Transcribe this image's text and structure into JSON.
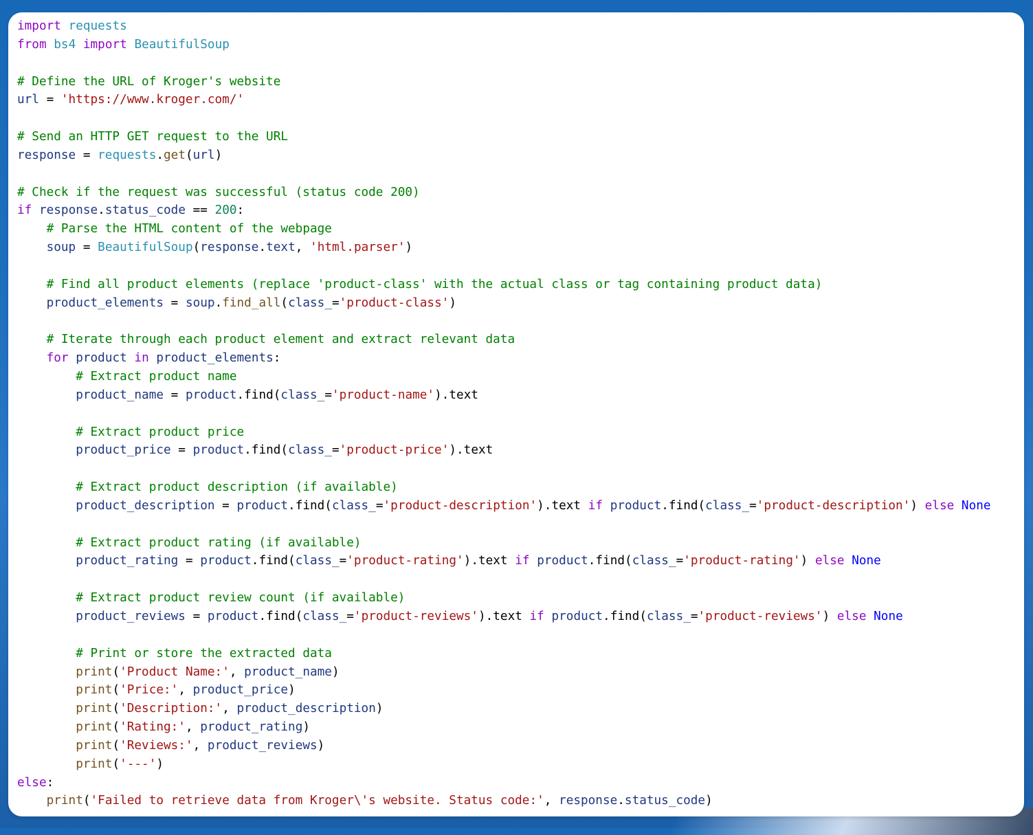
{
  "colors": {
    "keyword": "#8f08c4",
    "string": "#a31515",
    "comment": "#008000",
    "function": "#74531f",
    "class": "#2b91af",
    "number": "#098658",
    "variable": "#1f377f",
    "operator": "#000000",
    "constant": "#0000ff"
  },
  "code_lines": [
    [
      [
        "kw",
        "import"
      ],
      [
        "op",
        " "
      ],
      [
        "cls",
        "requests"
      ]
    ],
    [
      [
        "kw",
        "from"
      ],
      [
        "op",
        " "
      ],
      [
        "cls",
        "bs4"
      ],
      [
        "op",
        " "
      ],
      [
        "kw",
        "import"
      ],
      [
        "op",
        " "
      ],
      [
        "cls",
        "BeautifulSoup"
      ]
    ],
    [],
    [
      [
        "cm",
        "# Define the URL of Kroger's website"
      ]
    ],
    [
      [
        "var",
        "url"
      ],
      [
        "op",
        " = "
      ],
      [
        "str",
        "'https://www.kroger.com/'"
      ]
    ],
    [],
    [
      [
        "cm",
        "# Send an HTTP GET request to the URL"
      ]
    ],
    [
      [
        "var",
        "response"
      ],
      [
        "op",
        " = "
      ],
      [
        "cls",
        "requests"
      ],
      [
        "op",
        "."
      ],
      [
        "fn",
        "get"
      ],
      [
        "op",
        "("
      ],
      [
        "var",
        "url"
      ],
      [
        "op",
        ")"
      ]
    ],
    [],
    [
      [
        "cm",
        "# Check if the request was successful (status code 200)"
      ]
    ],
    [
      [
        "kw",
        "if"
      ],
      [
        "op",
        " "
      ],
      [
        "var",
        "response"
      ],
      [
        "op",
        "."
      ],
      [
        "var",
        "status_code"
      ],
      [
        "op",
        " == "
      ],
      [
        "num",
        "200"
      ],
      [
        "op",
        ":"
      ]
    ],
    [
      [
        "op",
        "    "
      ],
      [
        "cm",
        "# Parse the HTML content of the webpage"
      ]
    ],
    [
      [
        "op",
        "    "
      ],
      [
        "var",
        "soup"
      ],
      [
        "op",
        " = "
      ],
      [
        "cls",
        "BeautifulSoup"
      ],
      [
        "op",
        "("
      ],
      [
        "var",
        "response"
      ],
      [
        "op",
        "."
      ],
      [
        "var",
        "text"
      ],
      [
        "op",
        ", "
      ],
      [
        "str",
        "'html.parser'"
      ],
      [
        "op",
        ")"
      ]
    ],
    [],
    [
      [
        "op",
        "    "
      ],
      [
        "cm",
        "# Find all product elements (replace 'product-class' with the actual class or tag containing product data)"
      ]
    ],
    [
      [
        "op",
        "    "
      ],
      [
        "var",
        "product_elements"
      ],
      [
        "op",
        " = "
      ],
      [
        "var",
        "soup"
      ],
      [
        "op",
        "."
      ],
      [
        "fn",
        "find_all"
      ],
      [
        "op",
        "("
      ],
      [
        "var",
        "class_"
      ],
      [
        "op",
        "="
      ],
      [
        "str",
        "'product-class'"
      ],
      [
        "op",
        ")"
      ]
    ],
    [],
    [
      [
        "op",
        "    "
      ],
      [
        "cm",
        "# Iterate through each product element and extract relevant data"
      ]
    ],
    [
      [
        "op",
        "    "
      ],
      [
        "kw",
        "for"
      ],
      [
        "op",
        " "
      ],
      [
        "var",
        "product"
      ],
      [
        "op",
        " "
      ],
      [
        "kw",
        "in"
      ],
      [
        "op",
        " "
      ],
      [
        "var",
        "product_elements"
      ],
      [
        "op",
        ":"
      ]
    ],
    [
      [
        "op",
        "        "
      ],
      [
        "cm",
        "# Extract product name"
      ]
    ],
    [
      [
        "op",
        "        "
      ],
      [
        "var",
        "product_name"
      ],
      [
        "op",
        " = "
      ],
      [
        "var",
        "product"
      ],
      [
        "op",
        "."
      ],
      [
        "op",
        "find"
      ],
      [
        "op",
        "("
      ],
      [
        "var",
        "class_"
      ],
      [
        "op",
        "="
      ],
      [
        "str",
        "'product-name'"
      ],
      [
        "op",
        ")."
      ],
      [
        "op",
        "text"
      ]
    ],
    [],
    [
      [
        "op",
        "        "
      ],
      [
        "cm",
        "# Extract product price"
      ]
    ],
    [
      [
        "op",
        "        "
      ],
      [
        "var",
        "product_price"
      ],
      [
        "op",
        " = "
      ],
      [
        "var",
        "product"
      ],
      [
        "op",
        "."
      ],
      [
        "op",
        "find"
      ],
      [
        "op",
        "("
      ],
      [
        "var",
        "class_"
      ],
      [
        "op",
        "="
      ],
      [
        "str",
        "'product-price'"
      ],
      [
        "op",
        ")."
      ],
      [
        "op",
        "text"
      ]
    ],
    [],
    [
      [
        "op",
        "        "
      ],
      [
        "cm",
        "# Extract product description (if available)"
      ]
    ],
    [
      [
        "op",
        "        "
      ],
      [
        "var",
        "product_description"
      ],
      [
        "op",
        " = "
      ],
      [
        "var",
        "product"
      ],
      [
        "op",
        "."
      ],
      [
        "op",
        "find"
      ],
      [
        "op",
        "("
      ],
      [
        "var",
        "class_"
      ],
      [
        "op",
        "="
      ],
      [
        "str",
        "'product-description'"
      ],
      [
        "op",
        ")."
      ],
      [
        "op",
        "text"
      ],
      [
        "op",
        " "
      ],
      [
        "kw",
        "if"
      ],
      [
        "op",
        " "
      ],
      [
        "var",
        "product"
      ],
      [
        "op",
        "."
      ],
      [
        "op",
        "find"
      ],
      [
        "op",
        "("
      ],
      [
        "var",
        "class_"
      ],
      [
        "op",
        "="
      ],
      [
        "str",
        "'product-description'"
      ],
      [
        "op",
        ") "
      ],
      [
        "kw",
        "else"
      ],
      [
        "op",
        " "
      ],
      [
        "none",
        "None"
      ]
    ],
    [],
    [
      [
        "op",
        "        "
      ],
      [
        "cm",
        "# Extract product rating (if available)"
      ]
    ],
    [
      [
        "op",
        "        "
      ],
      [
        "var",
        "product_rating"
      ],
      [
        "op",
        " = "
      ],
      [
        "var",
        "product"
      ],
      [
        "op",
        "."
      ],
      [
        "op",
        "find"
      ],
      [
        "op",
        "("
      ],
      [
        "var",
        "class_"
      ],
      [
        "op",
        "="
      ],
      [
        "str",
        "'product-rating'"
      ],
      [
        "op",
        ")."
      ],
      [
        "op",
        "text"
      ],
      [
        "op",
        " "
      ],
      [
        "kw",
        "if"
      ],
      [
        "op",
        " "
      ],
      [
        "var",
        "product"
      ],
      [
        "op",
        "."
      ],
      [
        "op",
        "find"
      ],
      [
        "op",
        "("
      ],
      [
        "var",
        "class_"
      ],
      [
        "op",
        "="
      ],
      [
        "str",
        "'product-rating'"
      ],
      [
        "op",
        ") "
      ],
      [
        "kw",
        "else"
      ],
      [
        "op",
        " "
      ],
      [
        "none",
        "None"
      ]
    ],
    [],
    [
      [
        "op",
        "        "
      ],
      [
        "cm",
        "# Extract product review count (if available)"
      ]
    ],
    [
      [
        "op",
        "        "
      ],
      [
        "var",
        "product_reviews"
      ],
      [
        "op",
        " = "
      ],
      [
        "var",
        "product"
      ],
      [
        "op",
        "."
      ],
      [
        "op",
        "find"
      ],
      [
        "op",
        "("
      ],
      [
        "var",
        "class_"
      ],
      [
        "op",
        "="
      ],
      [
        "str",
        "'product-reviews'"
      ],
      [
        "op",
        ")."
      ],
      [
        "op",
        "text"
      ],
      [
        "op",
        " "
      ],
      [
        "kw",
        "if"
      ],
      [
        "op",
        " "
      ],
      [
        "var",
        "product"
      ],
      [
        "op",
        "."
      ],
      [
        "op",
        "find"
      ],
      [
        "op",
        "("
      ],
      [
        "var",
        "class_"
      ],
      [
        "op",
        "="
      ],
      [
        "str",
        "'product-reviews'"
      ],
      [
        "op",
        ") "
      ],
      [
        "kw",
        "else"
      ],
      [
        "op",
        " "
      ],
      [
        "none",
        "None"
      ]
    ],
    [],
    [
      [
        "op",
        "        "
      ],
      [
        "cm",
        "# Print or store the extracted data"
      ]
    ],
    [
      [
        "op",
        "        "
      ],
      [
        "fn",
        "print"
      ],
      [
        "op",
        "("
      ],
      [
        "str",
        "'Product Name:'"
      ],
      [
        "op",
        ", "
      ],
      [
        "var",
        "product_name"
      ],
      [
        "op",
        ")"
      ]
    ],
    [
      [
        "op",
        "        "
      ],
      [
        "fn",
        "print"
      ],
      [
        "op",
        "("
      ],
      [
        "str",
        "'Price:'"
      ],
      [
        "op",
        ", "
      ],
      [
        "var",
        "product_price"
      ],
      [
        "op",
        ")"
      ]
    ],
    [
      [
        "op",
        "        "
      ],
      [
        "fn",
        "print"
      ],
      [
        "op",
        "("
      ],
      [
        "str",
        "'Description:'"
      ],
      [
        "op",
        ", "
      ],
      [
        "var",
        "product_description"
      ],
      [
        "op",
        ")"
      ]
    ],
    [
      [
        "op",
        "        "
      ],
      [
        "fn",
        "print"
      ],
      [
        "op",
        "("
      ],
      [
        "str",
        "'Rating:'"
      ],
      [
        "op",
        ", "
      ],
      [
        "var",
        "product_rating"
      ],
      [
        "op",
        ")"
      ]
    ],
    [
      [
        "op",
        "        "
      ],
      [
        "fn",
        "print"
      ],
      [
        "op",
        "("
      ],
      [
        "str",
        "'Reviews:'"
      ],
      [
        "op",
        ", "
      ],
      [
        "var",
        "product_reviews"
      ],
      [
        "op",
        ")"
      ]
    ],
    [
      [
        "op",
        "        "
      ],
      [
        "fn",
        "print"
      ],
      [
        "op",
        "("
      ],
      [
        "str",
        "'---'"
      ],
      [
        "op",
        ")"
      ]
    ],
    [
      [
        "kw",
        "else"
      ],
      [
        "op",
        ":"
      ]
    ],
    [
      [
        "op",
        "    "
      ],
      [
        "fn",
        "print"
      ],
      [
        "op",
        "("
      ],
      [
        "str",
        "'Failed to retrieve data from Kroger\\'s website. Status code:'"
      ],
      [
        "op",
        ", "
      ],
      [
        "var",
        "response"
      ],
      [
        "op",
        "."
      ],
      [
        "var",
        "status_code"
      ],
      [
        "op",
        ")"
      ]
    ]
  ]
}
